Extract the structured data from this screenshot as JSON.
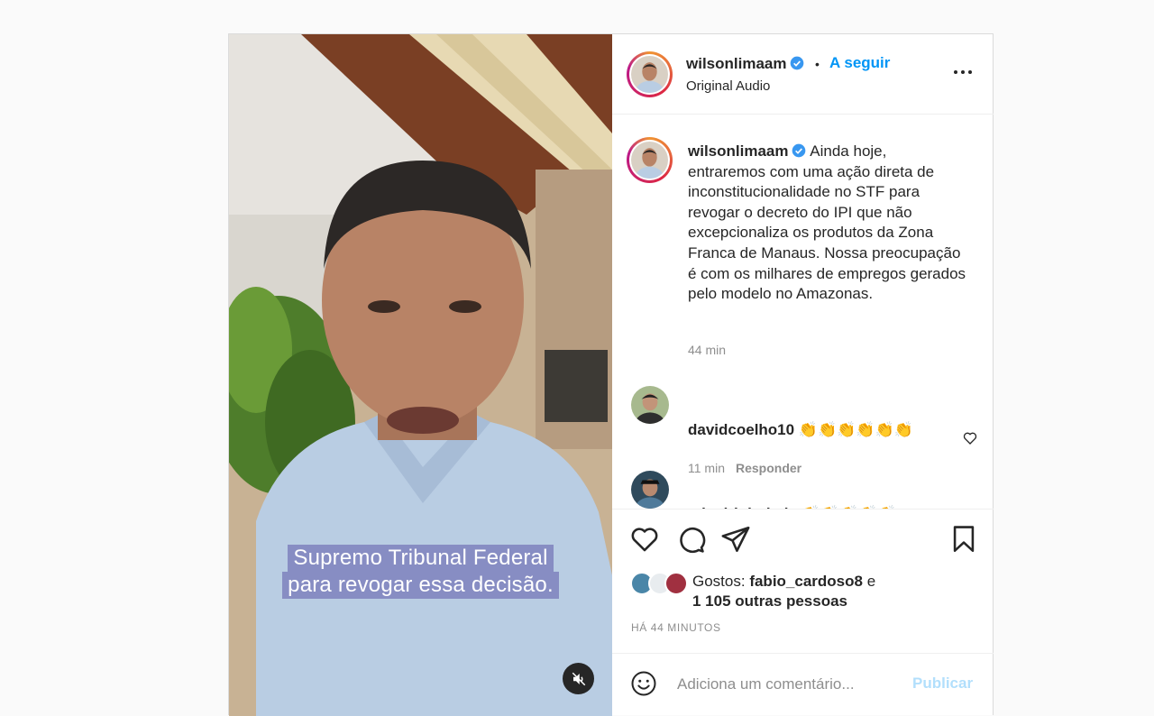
{
  "post": {
    "username": "wilsonlimaam",
    "follow_label": "A seguir",
    "separator": "•",
    "audio_label": "Original Audio",
    "subtitle_line1": "Supremo Tribunal Federal",
    "subtitle_line2": "para revogar essa decisão."
  },
  "caption": {
    "username": "wilsonlimaam",
    "text": "Ainda hoje, entraremos com uma ação direta de inconstitucionalidade no STF para revogar o decreto do IPI que não excepcionaliza os produtos da Zona Franca de Manaus. Nossa preocupação é com os milhares de empregos gerados pelo modelo no Amazonas.",
    "time": "44 min"
  },
  "comments": [
    {
      "username": "davidcoelho10",
      "text": "👏👏👏👏👏👏",
      "time": "11 min",
      "reply_label": "Responder"
    },
    {
      "username": "mineirinhobaia",
      "text": "👏👏👏👏👏"
    }
  ],
  "likes": {
    "prefix": "Gostos: ",
    "user": "fabio_cardoso8",
    "conj": " e",
    "others": "1 105 outras pessoas"
  },
  "time_ago": "HÁ 44 MINUTOS",
  "comment_box": {
    "placeholder": "Adiciona um comentário...",
    "publish_label": "Publicar"
  },
  "colors": {
    "link_blue": "#0095f6",
    "publish_disabled": "#b2dffc",
    "verified_blue": "#3897f0"
  },
  "icons": [
    "heart-icon",
    "comment-icon",
    "share-icon",
    "bookmark-icon",
    "emoji-icon",
    "mute-icon",
    "verified-icon",
    "more-icon"
  ]
}
